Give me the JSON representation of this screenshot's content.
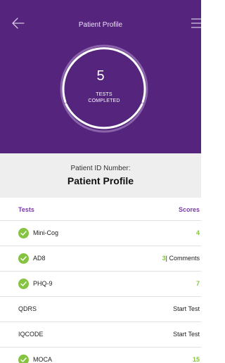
{
  "header": {
    "title": "Patient Profile",
    "back_icon": "arrow-left-icon",
    "menu_icon": "hamburger-menu-icon",
    "background": "#55247c"
  },
  "summary": {
    "count": "5",
    "label_line1": "TESTS",
    "label_line2": "COMPLETED"
  },
  "patient": {
    "id_label": "Patient ID Number:",
    "id_value": "Patient Profile"
  },
  "table": {
    "col_tests": "Tests",
    "col_scores": "Scores",
    "accent": "#7a3aa8",
    "score_color": "#86c340",
    "rows": [
      {
        "name": "Mini-Cog",
        "completed": true,
        "score": "4"
      },
      {
        "name": "AD8",
        "completed": true,
        "score": "3",
        "extra": "| Comments"
      },
      {
        "name": "PHQ-9",
        "completed": true,
        "score": "7"
      },
      {
        "name": "QDRS",
        "completed": false,
        "action": "Start Test"
      },
      {
        "name": "IQCODE",
        "completed": false,
        "action": "Start Test"
      },
      {
        "name": "MOCA",
        "completed": true,
        "score": "15"
      }
    ]
  }
}
